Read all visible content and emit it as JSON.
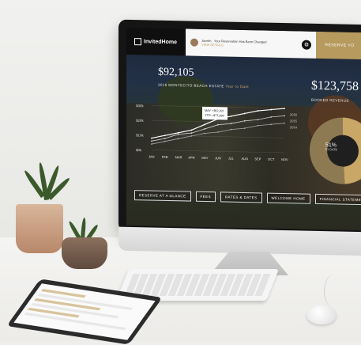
{
  "app": {
    "brand": "InvitedHome"
  },
  "notification": {
    "title": "Javelin · Your Reservation Has Been Changed",
    "subtitle": "VIEW DETAILS"
  },
  "topbar": {
    "reserve_label": "RESERVE YO"
  },
  "stats": {
    "left_value": "$92,105",
    "left_label": "2016 MONTECITO BEACH ESTATE",
    "left_label_suffix": "Year to Date",
    "right_value": "$123,758",
    "right_label": "BOOKED REVENUE"
  },
  "tooltip": {
    "line1": "MAY • $52,021",
    "line2": "YTD • $77,089"
  },
  "chart_data": {
    "type": "line",
    "title": "",
    "xlabel": "",
    "ylabel": "",
    "y_tick_labels": [
      "$30k",
      "$20k",
      "$10k",
      "$0k"
    ],
    "categories": [
      "JAN",
      "FEB",
      "MAR",
      "APR",
      "MAY",
      "JUN",
      "JUL",
      "AUG",
      "SEP",
      "OCT",
      "NOV"
    ],
    "series": [
      {
        "name": "2016",
        "values": [
          8,
          10,
          12,
          14,
          18,
          22,
          24,
          26,
          28,
          29,
          30
        ]
      },
      {
        "name": "2015",
        "values": [
          6,
          8,
          11,
          12,
          15,
          18,
          19,
          21,
          22,
          24,
          25
        ]
      },
      {
        "name": "2014",
        "values": [
          4,
          6,
          8,
          10,
          12,
          13,
          15,
          16,
          18,
          19,
          20
        ]
      }
    ],
    "donut": {
      "percent": 51,
      "label": "51%",
      "sub": "TO DATE"
    }
  },
  "nav_buttons": [
    {
      "label": "RESERVE AT A GLANCE"
    },
    {
      "label": "FEES"
    },
    {
      "label": "RATES & DATES"
    },
    {
      "label": "WELCOME HOME"
    },
    {
      "label": "FINANCIAL STATEMENT"
    }
  ],
  "colors": {
    "accent_gold": "#b79a5e"
  }
}
